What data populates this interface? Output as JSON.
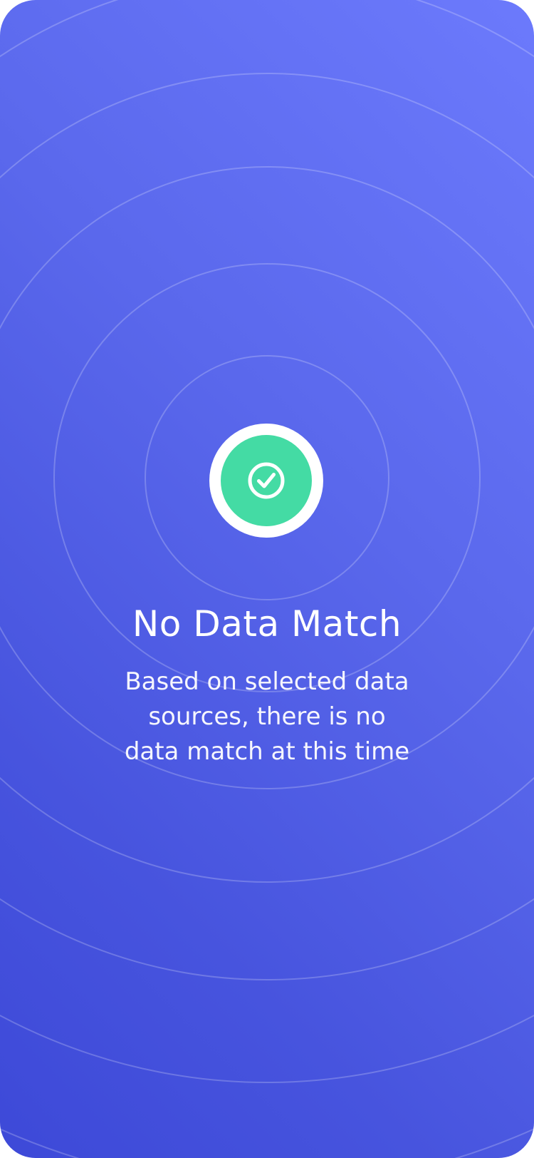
{
  "empty_state": {
    "icon": "check-circle-icon",
    "title": "No Data Match",
    "message": "Based on selected data sources, there is no data match at this time"
  },
  "colors": {
    "background_top": "#6c7afc",
    "background_bottom": "#3d49d8",
    "badge_ring": "#ffffff",
    "badge_fill": "#44dba4",
    "text": "#ffffff"
  }
}
